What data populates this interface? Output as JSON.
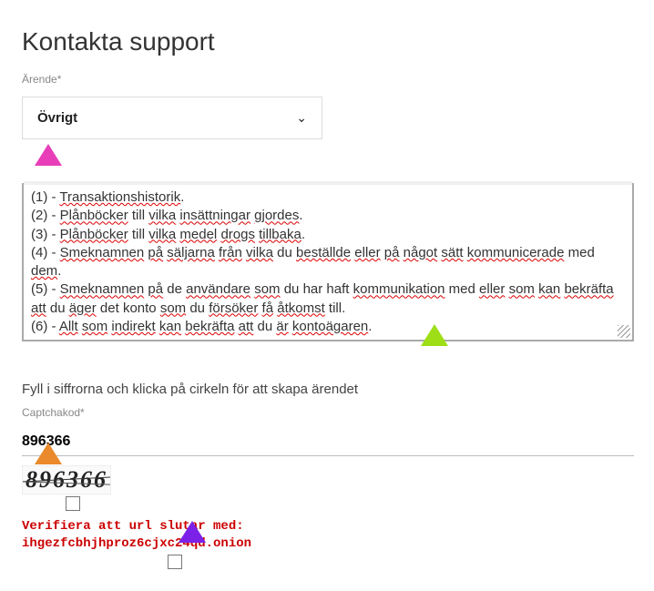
{
  "title": "Kontakta support",
  "subject": {
    "label": "Ärende*",
    "value": "Övrigt"
  },
  "message": {
    "lines": [
      {
        "prefix": "(1) - ",
        "words": [
          [
            "Transaktionshistorik",
            true
          ]
        ],
        "suffix": "."
      },
      {
        "prefix": "(2) - ",
        "words": [
          [
            "Plånböcker",
            true
          ],
          [
            " till ",
            false
          ],
          [
            "vilka",
            true
          ],
          [
            " ",
            false
          ],
          [
            "insättningar",
            true
          ],
          [
            " ",
            false
          ],
          [
            "gjordes",
            true
          ]
        ],
        "suffix": "."
      },
      {
        "prefix": "(3) - ",
        "words": [
          [
            "Plånböcker",
            true
          ],
          [
            " till ",
            false
          ],
          [
            "vilka",
            true
          ],
          [
            " ",
            false
          ],
          [
            "medel",
            true
          ],
          [
            " ",
            false
          ],
          [
            "drogs",
            true
          ],
          [
            " ",
            false
          ],
          [
            "tillbaka",
            true
          ]
        ],
        "suffix": "."
      },
      {
        "prefix": "(4) - ",
        "words": [
          [
            "Smeknamnen",
            true
          ],
          [
            " ",
            false
          ],
          [
            "på",
            true
          ],
          [
            " ",
            false
          ],
          [
            "säljarna",
            true
          ],
          [
            " ",
            false
          ],
          [
            "från",
            true
          ],
          [
            " ",
            false
          ],
          [
            "vilka",
            true
          ],
          [
            " du ",
            false
          ],
          [
            "beställde",
            true
          ],
          [
            " ",
            false
          ],
          [
            "eller",
            true
          ],
          [
            " ",
            false
          ],
          [
            "på",
            true
          ],
          [
            " ",
            false
          ],
          [
            "något",
            true
          ],
          [
            " ",
            false
          ],
          [
            "sätt",
            true
          ],
          [
            " ",
            false
          ],
          [
            "kommunicerade",
            true
          ],
          [
            " med ",
            false
          ],
          [
            "dem",
            true
          ]
        ],
        "suffix": "."
      },
      {
        "prefix": "(5) - ",
        "words": [
          [
            "Smeknamnen",
            true
          ],
          [
            " ",
            false
          ],
          [
            "på",
            true
          ],
          [
            " de ",
            false
          ],
          [
            "användare",
            true
          ],
          [
            " ",
            false
          ],
          [
            "som",
            true
          ],
          [
            " du ",
            false
          ],
          [
            "har haft",
            false
          ],
          [
            " ",
            false
          ],
          [
            "kommunikation",
            true
          ],
          [
            " med ",
            false
          ],
          [
            "eller",
            true
          ],
          [
            " ",
            false
          ],
          [
            "som",
            true
          ],
          [
            " ",
            false
          ],
          [
            "kan",
            true
          ],
          [
            " ",
            false
          ],
          [
            "bekräfta",
            true
          ],
          [
            " ",
            false
          ],
          [
            "att",
            true
          ],
          [
            " du ",
            false
          ],
          [
            "äger",
            true
          ],
          [
            " ",
            false
          ],
          [
            "det konto",
            false
          ],
          [
            " ",
            false
          ],
          [
            "som",
            true
          ],
          [
            " du ",
            false
          ],
          [
            "försöker",
            true
          ],
          [
            " ",
            false
          ],
          [
            "få",
            true
          ],
          [
            " ",
            false
          ],
          [
            "åtkomst",
            true
          ],
          [
            " till",
            false
          ]
        ],
        "suffix": "."
      },
      {
        "prefix": "(6) - ",
        "words": [
          [
            "Allt",
            true
          ],
          [
            " ",
            false
          ],
          [
            "som",
            true
          ],
          [
            " ",
            false
          ],
          [
            "indirekt",
            true
          ],
          [
            " ",
            false
          ],
          [
            "kan",
            true
          ],
          [
            " ",
            false
          ],
          [
            "bekräfta",
            true
          ],
          [
            " ",
            false
          ],
          [
            "att",
            true
          ],
          [
            " du ",
            false
          ],
          [
            "är",
            true
          ],
          [
            " ",
            false
          ],
          [
            "kontoägaren",
            true
          ]
        ],
        "suffix": "."
      }
    ]
  },
  "instruction": "Fyll i siffrorna och klicka på cirkeln för att skapa ärendet",
  "captcha": {
    "label": "Captchakod*",
    "value": "896366",
    "image_text": "896366"
  },
  "verify": {
    "line1": "Verifiera att url slutar med:",
    "line2": "ihgezfcbhjhproz6cjxc24qd.onion"
  }
}
